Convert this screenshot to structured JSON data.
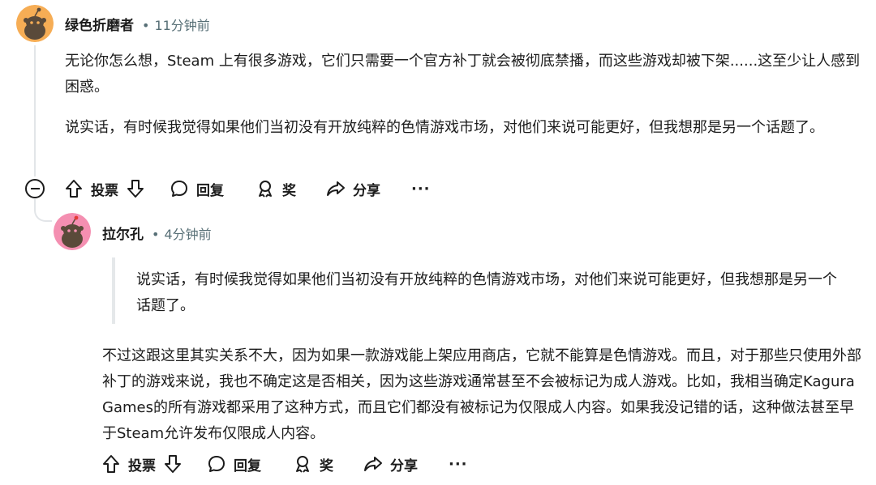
{
  "colors": {
    "text": "#1c1c1c",
    "meta": "#576f76",
    "thread_line": "#e2e5e8",
    "avatar1": "#f6ad55",
    "avatar2": "#f48fb1"
  },
  "comments": [
    {
      "username": "绿色折磨者",
      "separator": "•",
      "time": "11分钟前",
      "paragraphs": [
        "无论你怎么想，Steam 上有很多游戏，它们只需要一个官方补丁就会被彻底禁播，而这些游戏却被下架......这至少让人感到困惑。",
        "说实话，有时候我觉得如果他们当初没有开放纯粹的色情游戏市场，对他们来说可能更好，但我想那是另一个话题了。"
      ],
      "actions": {
        "vote_label": "投票",
        "reply_label": "回复",
        "award_label": "奖",
        "share_label": "分享",
        "more_label": "···"
      }
    },
    {
      "username": "拉尔孔",
      "separator": "•",
      "time": "4分钟前",
      "quote": "说实话，有时候我觉得如果他们当初没有开放纯粹的色情游戏市场，对他们来说可能更好，但我想那是另一个话题了。",
      "paragraphs": [
        "不过这跟这里其实关系不大，因为如果一款游戏能上架应用商店，它就不能算是色情游戏。而且，对于那些只使用外部补丁的游戏来说，我也不确定这是否相关，因为这些游戏通常甚至不会被标记为成人游戏。比如，我相当确定Kagura Games的所有游戏都采用了这种方式，而且它们都没有被标记为仅限成人内容。如果我没记错的话，这种做法甚至早于Steam允许发布仅限成人内容。"
      ],
      "actions": {
        "vote_label": "投票",
        "reply_label": "回复",
        "award_label": "奖",
        "share_label": "分享",
        "more_label": "···"
      }
    }
  ],
  "icons": {
    "avatar": "reddit-snoo-avatar",
    "upvote": "arrow-up-icon",
    "downvote": "arrow-down-icon",
    "reply": "speech-bubble-icon",
    "award": "award-ribbon-icon",
    "share": "share-arrow-icon",
    "collapse": "minus-circle-icon"
  }
}
